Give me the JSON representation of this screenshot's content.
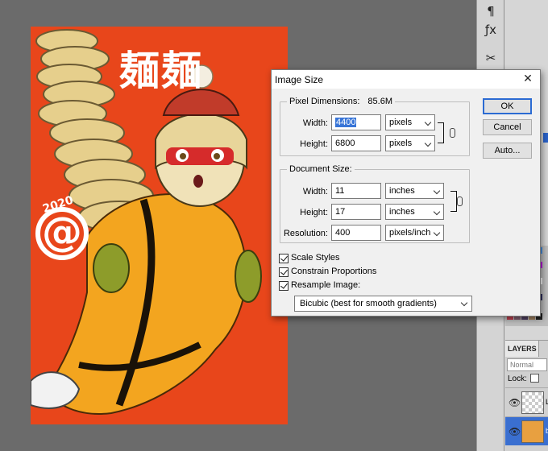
{
  "artwork": {
    "title_text": "麺麺",
    "year": "2020",
    "logo_symbol": "@"
  },
  "tools": {
    "icons": [
      "paragraph-icon",
      "fx-icon",
      "wrench-icon"
    ],
    "glyphs": [
      "¶",
      "ƒx",
      "✂"
    ]
  },
  "layers": {
    "tab_label": "LAYERS",
    "blend_mode": "Normal",
    "lock_label": "Lock:",
    "rows": [
      {
        "name": "L"
      },
      {
        "name": "b"
      }
    ]
  },
  "dialog": {
    "title": "Image Size",
    "close_glyph": "✕",
    "pixel_dimensions": {
      "label": "Pixel Dimensions:",
      "value": "85.6M",
      "width_label": "Width:",
      "width_value": "4400",
      "width_unit": "pixels",
      "height_label": "Height:",
      "height_value": "6800",
      "height_unit": "pixels"
    },
    "document_size": {
      "label": "Document Size:",
      "width_label": "Width:",
      "width_value": "11",
      "width_unit": "inches",
      "height_label": "Height:",
      "height_value": "17",
      "height_unit": "inches",
      "resolution_label": "Resolution:",
      "resolution_value": "400",
      "resolution_unit": "pixels/inch"
    },
    "options": {
      "scale_styles": "Scale Styles",
      "constrain_proportions": "Constrain Proportions",
      "resample_image": "Resample Image:",
      "resample_method": "Bicubic (best for smooth gradients)"
    },
    "buttons": {
      "ok": "OK",
      "cancel": "Cancel",
      "auto": "Auto..."
    }
  },
  "colors": {
    "canvas_bg": "#e8461b",
    "workspace_bg": "#6b6b6b",
    "accent": "#2b6bd3"
  }
}
